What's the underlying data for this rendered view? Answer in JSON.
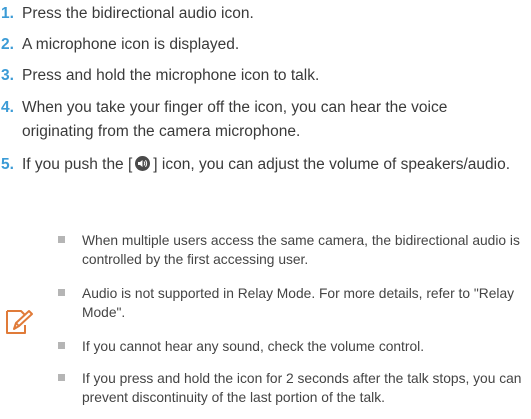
{
  "steps": [
    {
      "num": "1.",
      "text": "Press the bidirectional audio icon."
    },
    {
      "num": "2.",
      "text": "A microphone icon is displayed."
    },
    {
      "num": "3.",
      "text": "Press and hold the microphone icon to talk."
    },
    {
      "num": "4.",
      "text": "When you take your finger off the icon, you can hear the voice originating from the camera microphone."
    },
    {
      "num": "5.",
      "text_before": "If you push the [",
      "text_after": "] icon, you can adjust the volume of speakers/audio."
    }
  ],
  "notes": [
    "When multiple users access the same camera, the bidirectional audio is controlled by the first accessing user.",
    "Audio is not supported in Relay Mode. For more details, refer to \"Relay Mode\".",
    "If you cannot hear any sound, check the volume control.",
    "If you press and hold the icon for 2 seconds after the talk stops, you can prevent discontinuity of the last portion of the talk."
  ],
  "icons": {
    "volume": "speaker-icon",
    "note": "note-pencil-icon"
  },
  "colors": {
    "step_number": "#3b9bd6",
    "note_icon": "#e07b39",
    "bullet": "#b5b5b5"
  }
}
